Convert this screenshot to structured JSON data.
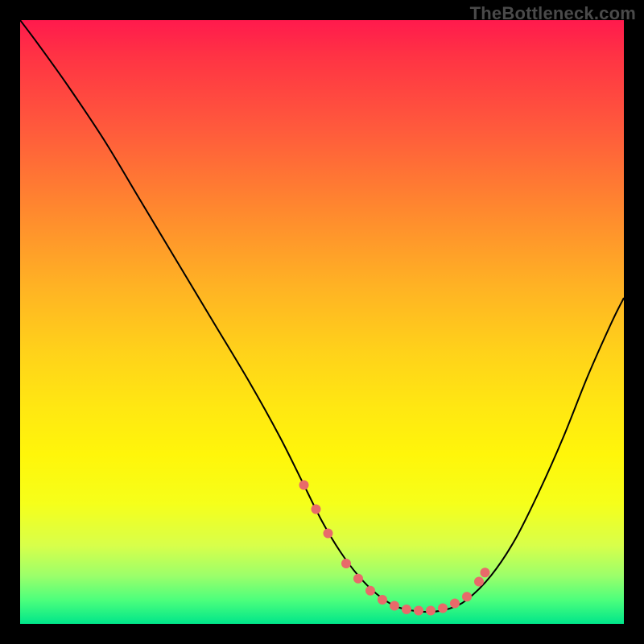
{
  "watermark": "TheBottleneck.com",
  "chart_data": {
    "type": "line",
    "title": "",
    "xlabel": "",
    "ylabel": "",
    "xlim": [
      0,
      100
    ],
    "ylim": [
      0,
      100
    ],
    "curve": {
      "x": [
        0,
        3,
        8,
        14,
        20,
        26,
        32,
        38,
        43,
        47,
        50,
        53,
        56,
        59,
        62,
        65,
        68,
        71,
        74,
        78,
        82,
        86,
        90,
        94,
        98,
        100
      ],
      "y": [
        100,
        96,
        89,
        80,
        70,
        60,
        50,
        40,
        31,
        23,
        17,
        12,
        8,
        5,
        3,
        2.2,
        2,
        2.5,
        4,
        8,
        14,
        22,
        31,
        41,
        50,
        54
      ]
    },
    "markers": {
      "x": [
        47,
        49,
        51,
        54,
        56,
        58,
        60,
        62,
        64,
        66,
        68,
        70,
        72,
        74,
        76,
        77
      ],
      "y": [
        23,
        19,
        15,
        10,
        7.5,
        5.5,
        4,
        3,
        2.4,
        2.2,
        2.2,
        2.6,
        3.4,
        4.5,
        7,
        8.5
      ],
      "color": "#e86a6a",
      "radius": 6
    }
  }
}
